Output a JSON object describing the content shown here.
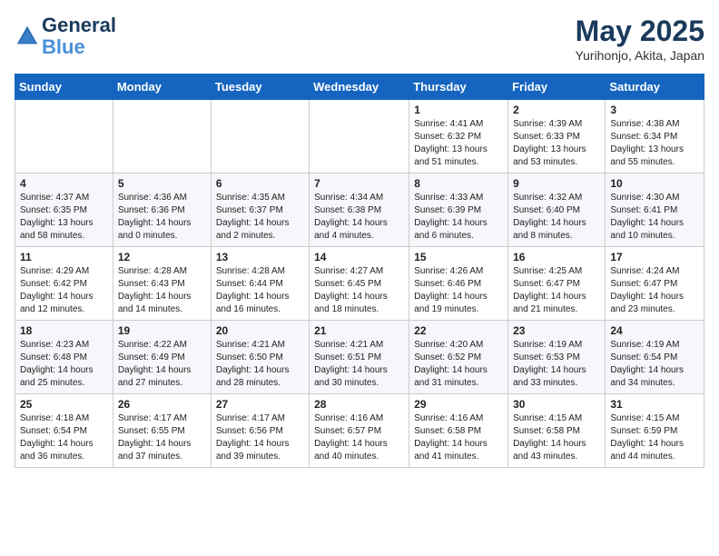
{
  "header": {
    "logo_line1": "General",
    "logo_line2": "Blue",
    "month": "May 2025",
    "location": "Yurihonjo, Akita, Japan"
  },
  "weekdays": [
    "Sunday",
    "Monday",
    "Tuesday",
    "Wednesday",
    "Thursday",
    "Friday",
    "Saturday"
  ],
  "weeks": [
    [
      {
        "day": "",
        "sunrise": "",
        "sunset": "",
        "daylight": ""
      },
      {
        "day": "",
        "sunrise": "",
        "sunset": "",
        "daylight": ""
      },
      {
        "day": "",
        "sunrise": "",
        "sunset": "",
        "daylight": ""
      },
      {
        "day": "",
        "sunrise": "",
        "sunset": "",
        "daylight": ""
      },
      {
        "day": "1",
        "sunrise": "Sunrise: 4:41 AM",
        "sunset": "Sunset: 6:32 PM",
        "daylight": "Daylight: 13 hours and 51 minutes."
      },
      {
        "day": "2",
        "sunrise": "Sunrise: 4:39 AM",
        "sunset": "Sunset: 6:33 PM",
        "daylight": "Daylight: 13 hours and 53 minutes."
      },
      {
        "day": "3",
        "sunrise": "Sunrise: 4:38 AM",
        "sunset": "Sunset: 6:34 PM",
        "daylight": "Daylight: 13 hours and 55 minutes."
      }
    ],
    [
      {
        "day": "4",
        "sunrise": "Sunrise: 4:37 AM",
        "sunset": "Sunset: 6:35 PM",
        "daylight": "Daylight: 13 hours and 58 minutes."
      },
      {
        "day": "5",
        "sunrise": "Sunrise: 4:36 AM",
        "sunset": "Sunset: 6:36 PM",
        "daylight": "Daylight: 14 hours and 0 minutes."
      },
      {
        "day": "6",
        "sunrise": "Sunrise: 4:35 AM",
        "sunset": "Sunset: 6:37 PM",
        "daylight": "Daylight: 14 hours and 2 minutes."
      },
      {
        "day": "7",
        "sunrise": "Sunrise: 4:34 AM",
        "sunset": "Sunset: 6:38 PM",
        "daylight": "Daylight: 14 hours and 4 minutes."
      },
      {
        "day": "8",
        "sunrise": "Sunrise: 4:33 AM",
        "sunset": "Sunset: 6:39 PM",
        "daylight": "Daylight: 14 hours and 6 minutes."
      },
      {
        "day": "9",
        "sunrise": "Sunrise: 4:32 AM",
        "sunset": "Sunset: 6:40 PM",
        "daylight": "Daylight: 14 hours and 8 minutes."
      },
      {
        "day": "10",
        "sunrise": "Sunrise: 4:30 AM",
        "sunset": "Sunset: 6:41 PM",
        "daylight": "Daylight: 14 hours and 10 minutes."
      }
    ],
    [
      {
        "day": "11",
        "sunrise": "Sunrise: 4:29 AM",
        "sunset": "Sunset: 6:42 PM",
        "daylight": "Daylight: 14 hours and 12 minutes."
      },
      {
        "day": "12",
        "sunrise": "Sunrise: 4:28 AM",
        "sunset": "Sunset: 6:43 PM",
        "daylight": "Daylight: 14 hours and 14 minutes."
      },
      {
        "day": "13",
        "sunrise": "Sunrise: 4:28 AM",
        "sunset": "Sunset: 6:44 PM",
        "daylight": "Daylight: 14 hours and 16 minutes."
      },
      {
        "day": "14",
        "sunrise": "Sunrise: 4:27 AM",
        "sunset": "Sunset: 6:45 PM",
        "daylight": "Daylight: 14 hours and 18 minutes."
      },
      {
        "day": "15",
        "sunrise": "Sunrise: 4:26 AM",
        "sunset": "Sunset: 6:46 PM",
        "daylight": "Daylight: 14 hours and 19 minutes."
      },
      {
        "day": "16",
        "sunrise": "Sunrise: 4:25 AM",
        "sunset": "Sunset: 6:47 PM",
        "daylight": "Daylight: 14 hours and 21 minutes."
      },
      {
        "day": "17",
        "sunrise": "Sunrise: 4:24 AM",
        "sunset": "Sunset: 6:47 PM",
        "daylight": "Daylight: 14 hours and 23 minutes."
      }
    ],
    [
      {
        "day": "18",
        "sunrise": "Sunrise: 4:23 AM",
        "sunset": "Sunset: 6:48 PM",
        "daylight": "Daylight: 14 hours and 25 minutes."
      },
      {
        "day": "19",
        "sunrise": "Sunrise: 4:22 AM",
        "sunset": "Sunset: 6:49 PM",
        "daylight": "Daylight: 14 hours and 27 minutes."
      },
      {
        "day": "20",
        "sunrise": "Sunrise: 4:21 AM",
        "sunset": "Sunset: 6:50 PM",
        "daylight": "Daylight: 14 hours and 28 minutes."
      },
      {
        "day": "21",
        "sunrise": "Sunrise: 4:21 AM",
        "sunset": "Sunset: 6:51 PM",
        "daylight": "Daylight: 14 hours and 30 minutes."
      },
      {
        "day": "22",
        "sunrise": "Sunrise: 4:20 AM",
        "sunset": "Sunset: 6:52 PM",
        "daylight": "Daylight: 14 hours and 31 minutes."
      },
      {
        "day": "23",
        "sunrise": "Sunrise: 4:19 AM",
        "sunset": "Sunset: 6:53 PM",
        "daylight": "Daylight: 14 hours and 33 minutes."
      },
      {
        "day": "24",
        "sunrise": "Sunrise: 4:19 AM",
        "sunset": "Sunset: 6:54 PM",
        "daylight": "Daylight: 14 hours and 34 minutes."
      }
    ],
    [
      {
        "day": "25",
        "sunrise": "Sunrise: 4:18 AM",
        "sunset": "Sunset: 6:54 PM",
        "daylight": "Daylight: 14 hours and 36 minutes."
      },
      {
        "day": "26",
        "sunrise": "Sunrise: 4:17 AM",
        "sunset": "Sunset: 6:55 PM",
        "daylight": "Daylight: 14 hours and 37 minutes."
      },
      {
        "day": "27",
        "sunrise": "Sunrise: 4:17 AM",
        "sunset": "Sunset: 6:56 PM",
        "daylight": "Daylight: 14 hours and 39 minutes."
      },
      {
        "day": "28",
        "sunrise": "Sunrise: 4:16 AM",
        "sunset": "Sunset: 6:57 PM",
        "daylight": "Daylight: 14 hours and 40 minutes."
      },
      {
        "day": "29",
        "sunrise": "Sunrise: 4:16 AM",
        "sunset": "Sunset: 6:58 PM",
        "daylight": "Daylight: 14 hours and 41 minutes."
      },
      {
        "day": "30",
        "sunrise": "Sunrise: 4:15 AM",
        "sunset": "Sunset: 6:58 PM",
        "daylight": "Daylight: 14 hours and 43 minutes."
      },
      {
        "day": "31",
        "sunrise": "Sunrise: 4:15 AM",
        "sunset": "Sunset: 6:59 PM",
        "daylight": "Daylight: 14 hours and 44 minutes."
      }
    ]
  ]
}
